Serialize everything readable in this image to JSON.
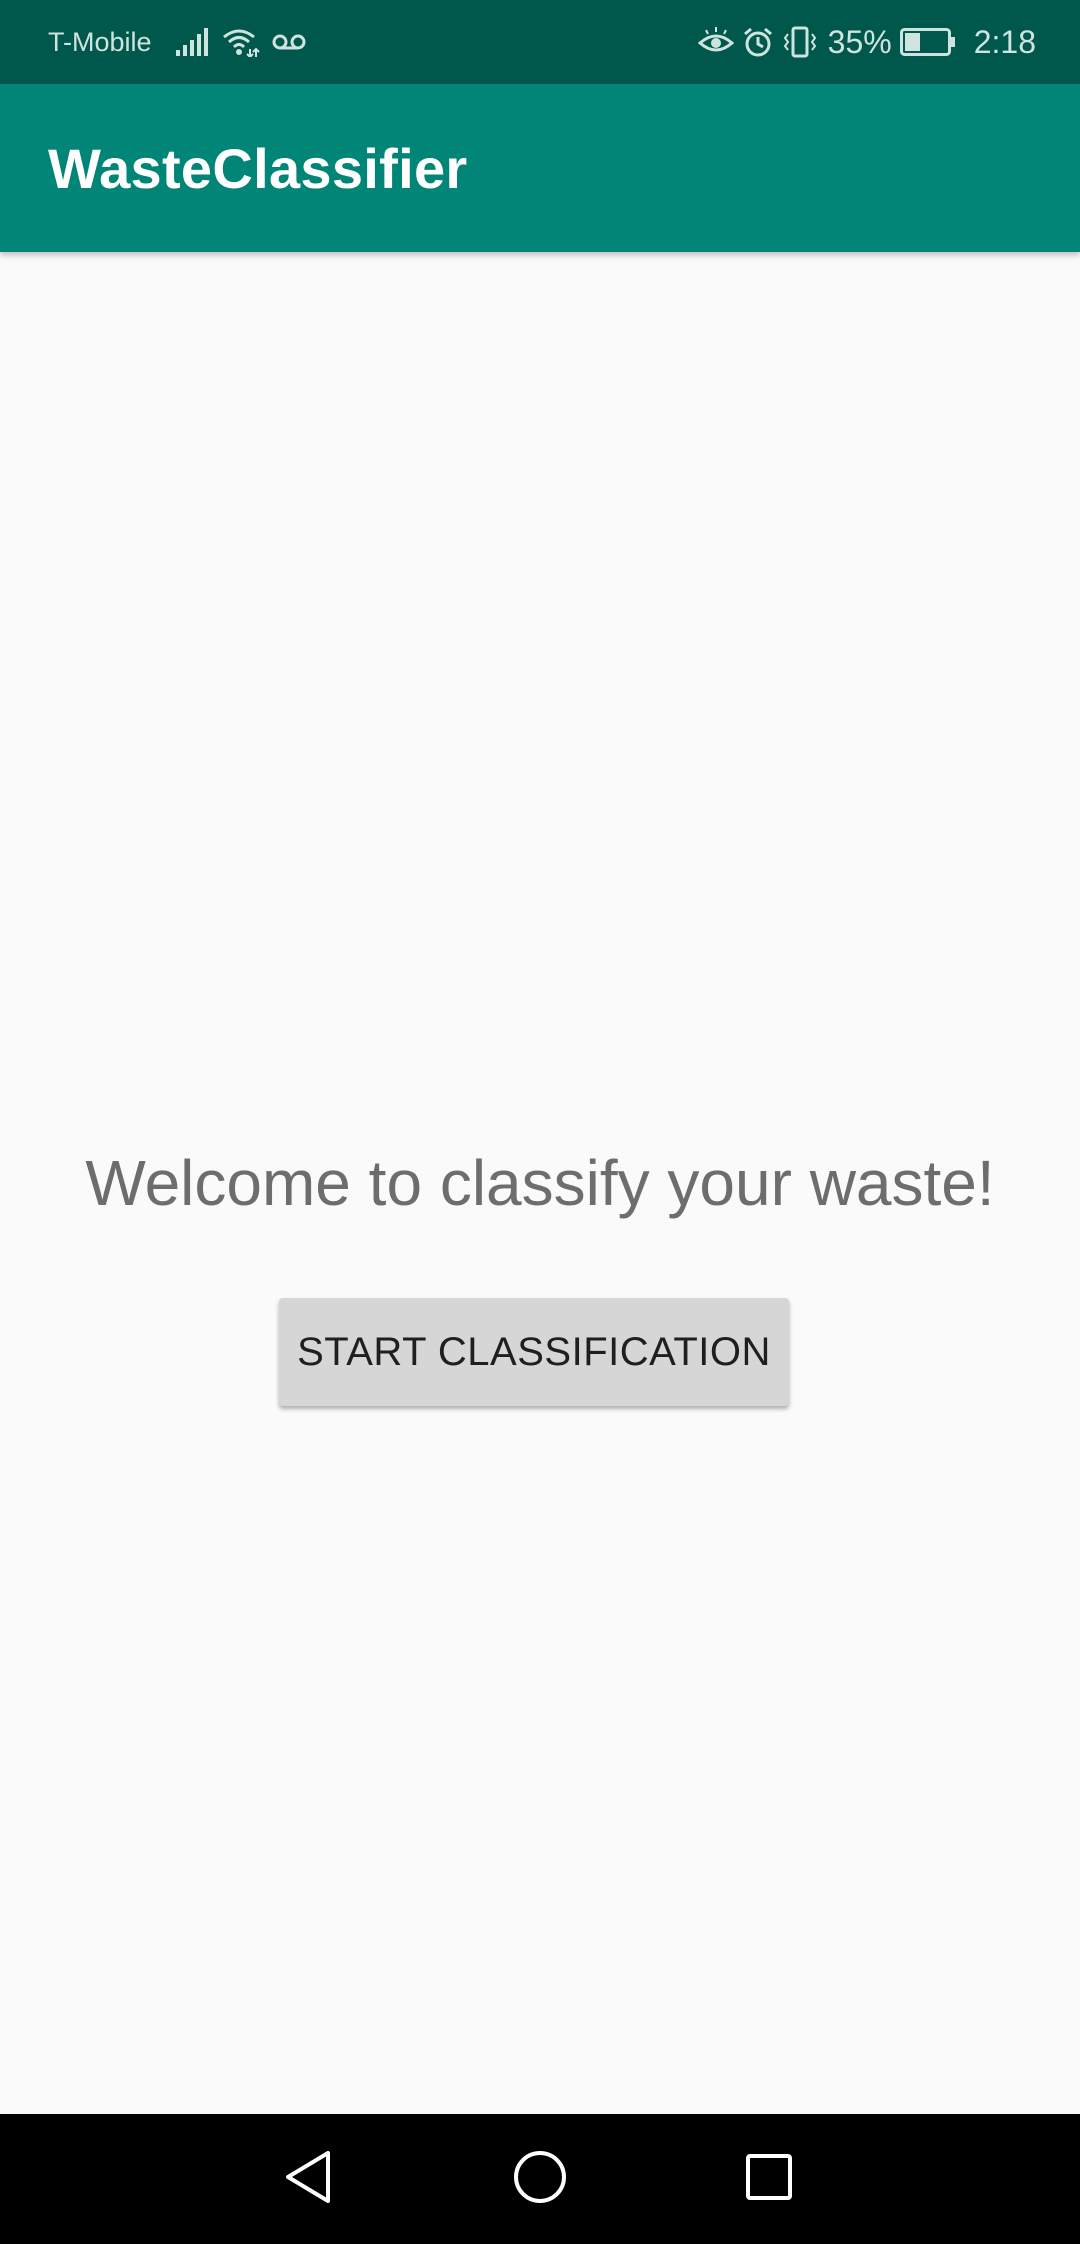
{
  "status_bar": {
    "carrier": "T-Mobile",
    "battery_percent": "35%",
    "time": "2:18",
    "battery_level": 0.35,
    "icons": {
      "signal": "signal-icon",
      "wifi": "wifi-icon",
      "voicemail": "voicemail-icon",
      "eye": "eye-comfort-icon",
      "alarm": "alarm-icon",
      "vibrate": "vibrate-icon",
      "battery": "battery-icon"
    }
  },
  "app_bar": {
    "title": "WasteClassifier"
  },
  "main": {
    "welcome_text": "Welcome to classify your waste!",
    "start_button_label": "START CLASSIFICATION"
  },
  "nav_bar": {
    "icons": [
      "back-icon",
      "home-icon",
      "recents-icon"
    ]
  },
  "colors": {
    "status_bar": "#00574b",
    "app_bar": "#008577",
    "background": "#fafafa",
    "button": "#d6d6d6"
  }
}
